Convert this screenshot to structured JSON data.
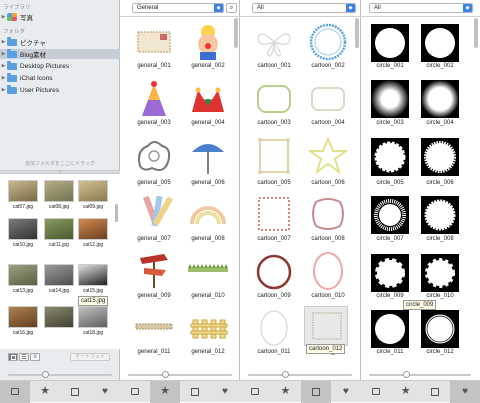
{
  "sidebar": {
    "section_library": "ライブラリ",
    "library_items": [
      {
        "label": "写真",
        "icon": "photos-icon"
      }
    ],
    "section_folders": "フォルダ",
    "folders": [
      {
        "label": "ピクチャ",
        "expanded": false
      },
      {
        "label": "Blog素材",
        "expanded": false,
        "selected": true
      },
      {
        "label": "Desktop Pictures",
        "expanded": false
      },
      {
        "label": "iChat Icons",
        "expanded": false
      },
      {
        "label": "User Pictures",
        "expanded": false
      }
    ],
    "drag_hint": "追加フォルダをここにドラッグ",
    "photos": [
      "cat07.jpg",
      "cat08.jpg",
      "cat09.jpg",
      "cat10.jpg",
      "cat11.jpg",
      "cat12.jpg",
      "cat13.jpg",
      "cat14.jpg",
      "cat15.jpg",
      "cat16.jpg",
      "",
      "cat18.jpg"
    ],
    "tooltip": "cat15.jpg",
    "autofade_label": "オートフェイ"
  },
  "general_panel": {
    "dropdown": "General",
    "items": [
      "general_001",
      "general_002",
      "general_003",
      "general_004",
      "general_005",
      "general_006",
      "general_007",
      "general_008",
      "general_009",
      "general_010",
      "general_011",
      "general_012"
    ]
  },
  "cartoon_panel": {
    "dropdown": "All",
    "items": [
      "cartoon_001",
      "cartoon_002",
      "cartoon_003",
      "cartoon_004",
      "cartoon_005",
      "cartoon_006",
      "cartoon_007",
      "cartoon_008",
      "cartoon_009",
      "cartoon_010",
      "cartoon_011",
      "cartoon_012"
    ],
    "tooltip": "cartoon_012"
  },
  "circle_panel": {
    "dropdown": "All",
    "items": [
      "circle_001",
      "circle_002",
      "circle_003",
      "circle_004",
      "circle_005",
      "circle_006",
      "circle_007",
      "circle_008",
      "circle_009",
      "circle_010",
      "circle_011",
      "circle_012"
    ],
    "tooltip": "circle_009"
  },
  "tabs": [
    "image-tab",
    "star-tab",
    "square-tab",
    "heart-tab"
  ],
  "active_tabs": {
    "p1": 0,
    "p2": 1,
    "p3": 2,
    "p4": 3
  },
  "colors": {
    "accent": "#3b82e8",
    "sidebar_bg": "#e9ecef",
    "selected": "#c7cdd4"
  }
}
